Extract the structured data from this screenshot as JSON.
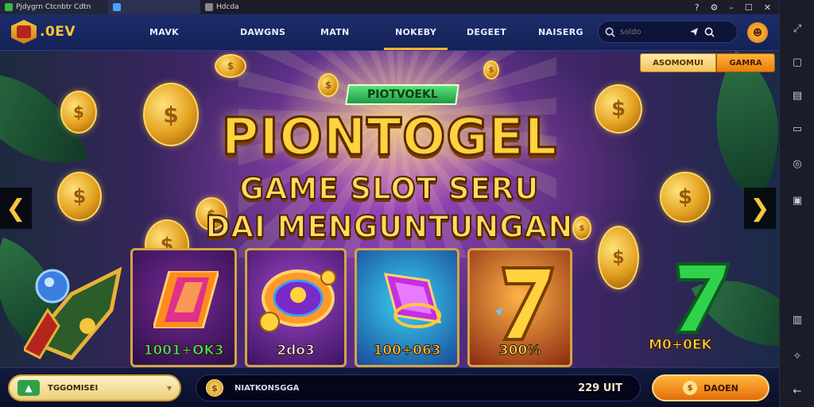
{
  "tabs": [
    {
      "label": "Pjdygrn Ctcnbtr Cdtn"
    },
    {
      "label": ""
    },
    {
      "label": "Hdcda"
    }
  ],
  "window_controls": {
    "help": "?",
    "gear": "⚙",
    "minimize": "–",
    "maximize": "☐",
    "close": "✕"
  },
  "navbar": {
    "logo_text": ".0EV",
    "items": [
      "MAVK",
      "DAWGNS",
      "MATN",
      "NOKEBY",
      "DEGEET",
      "NAISERG"
    ],
    "active_index": 3,
    "search_placeholder": "soldo"
  },
  "hero": {
    "pill_left": "ASOMOMUI",
    "pill_right": "GAMRA",
    "tag": "PIOTVOEKL",
    "title_line1": "PIONTOGEL",
    "title_line2": "GAME SLOT SERU",
    "title_line3": "DAI MENGUNTUNGAN",
    "cards": [
      {
        "label": "1001+OK3",
        "color": "#4fe36a"
      },
      {
        "label": "2do3",
        "color": "#f5f0ff"
      },
      {
        "label": "100+063",
        "color": "#ffbe3a"
      },
      {
        "label": "300%",
        "color": "#ffd65a"
      }
    ],
    "right_label": "M0+0EK",
    "prev_arrow": "❮",
    "next_arrow": "❯"
  },
  "bottom": {
    "promo_text": "TGGOMISEI",
    "balance_label": "NIATKONSGGA",
    "balance_amount": "229 UIT",
    "deposit_label": "DAOEN"
  },
  "colors": {
    "accent": "#f6b52a",
    "nav_bg": "#1d2d6b",
    "deposit": "#e46d09"
  }
}
